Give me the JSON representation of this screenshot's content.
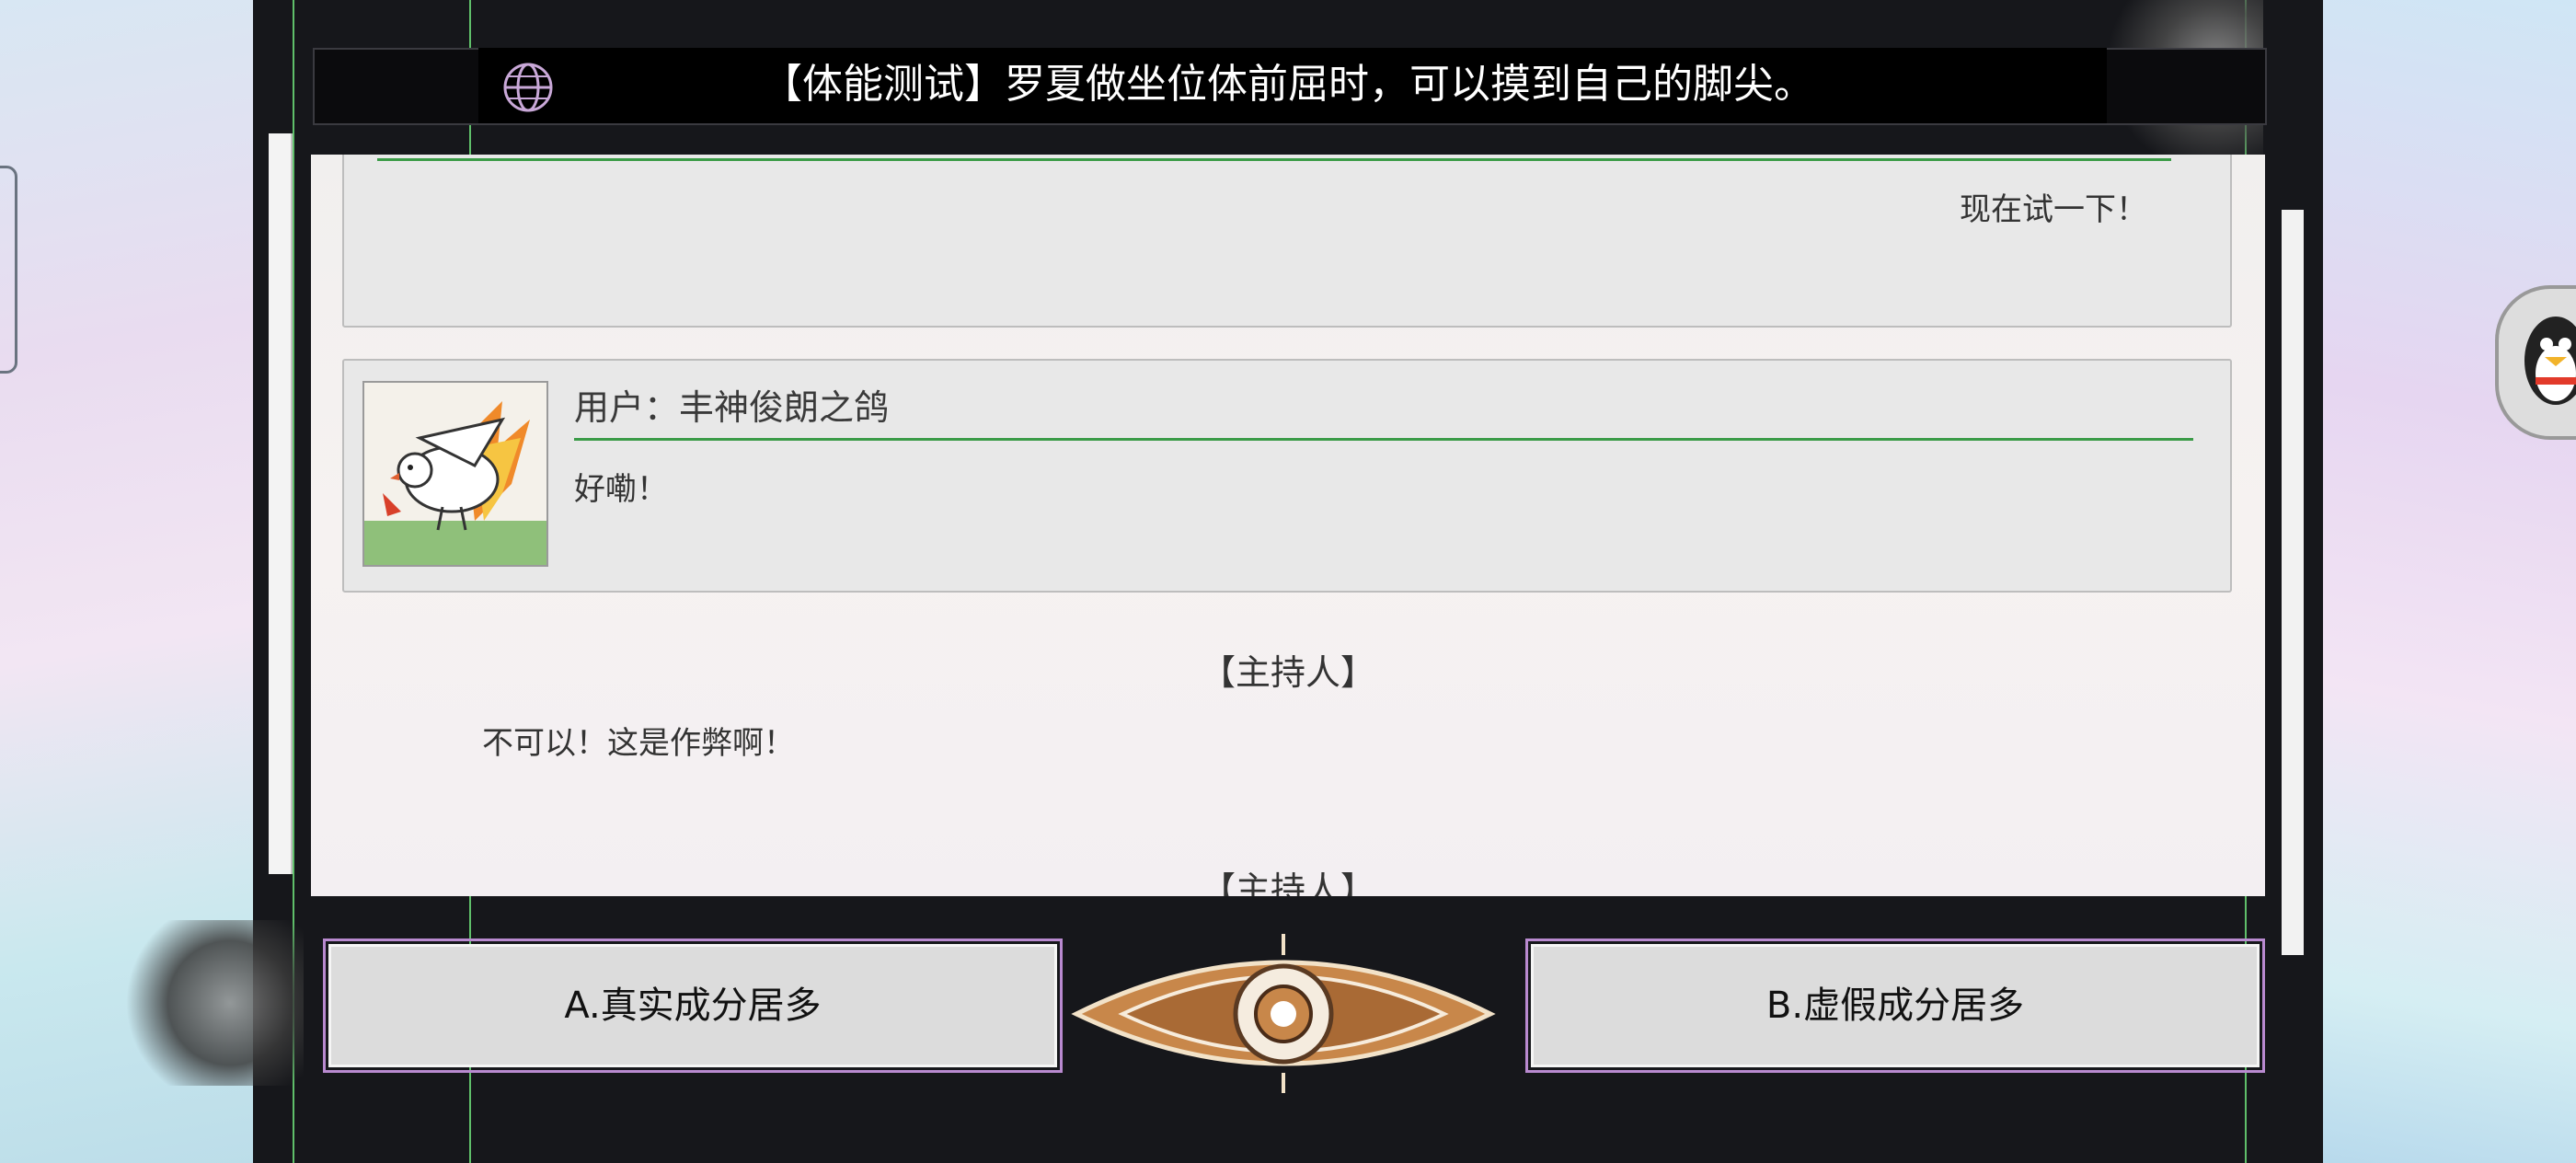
{
  "header": {
    "globe_icon": "globe-icon",
    "question": "【体能测试】罗夏做坐位体前屈时，可以摸到自己的脚尖。"
  },
  "chat": {
    "message1": {
      "text": "现在试一下！"
    },
    "message2": {
      "user": "用户：丰神俊朗之鸽",
      "text": "好嘞！"
    },
    "host_label": "【主持人】",
    "host_message": "不可以！这是作弊啊！",
    "host_label_2": "【主持人】"
  },
  "options": {
    "a_label": "A.真实成分居多",
    "b_label": "B.虚假成分居多"
  },
  "colors": {
    "accent_green": "#3a9b47",
    "option_border": "#b98ad0"
  }
}
